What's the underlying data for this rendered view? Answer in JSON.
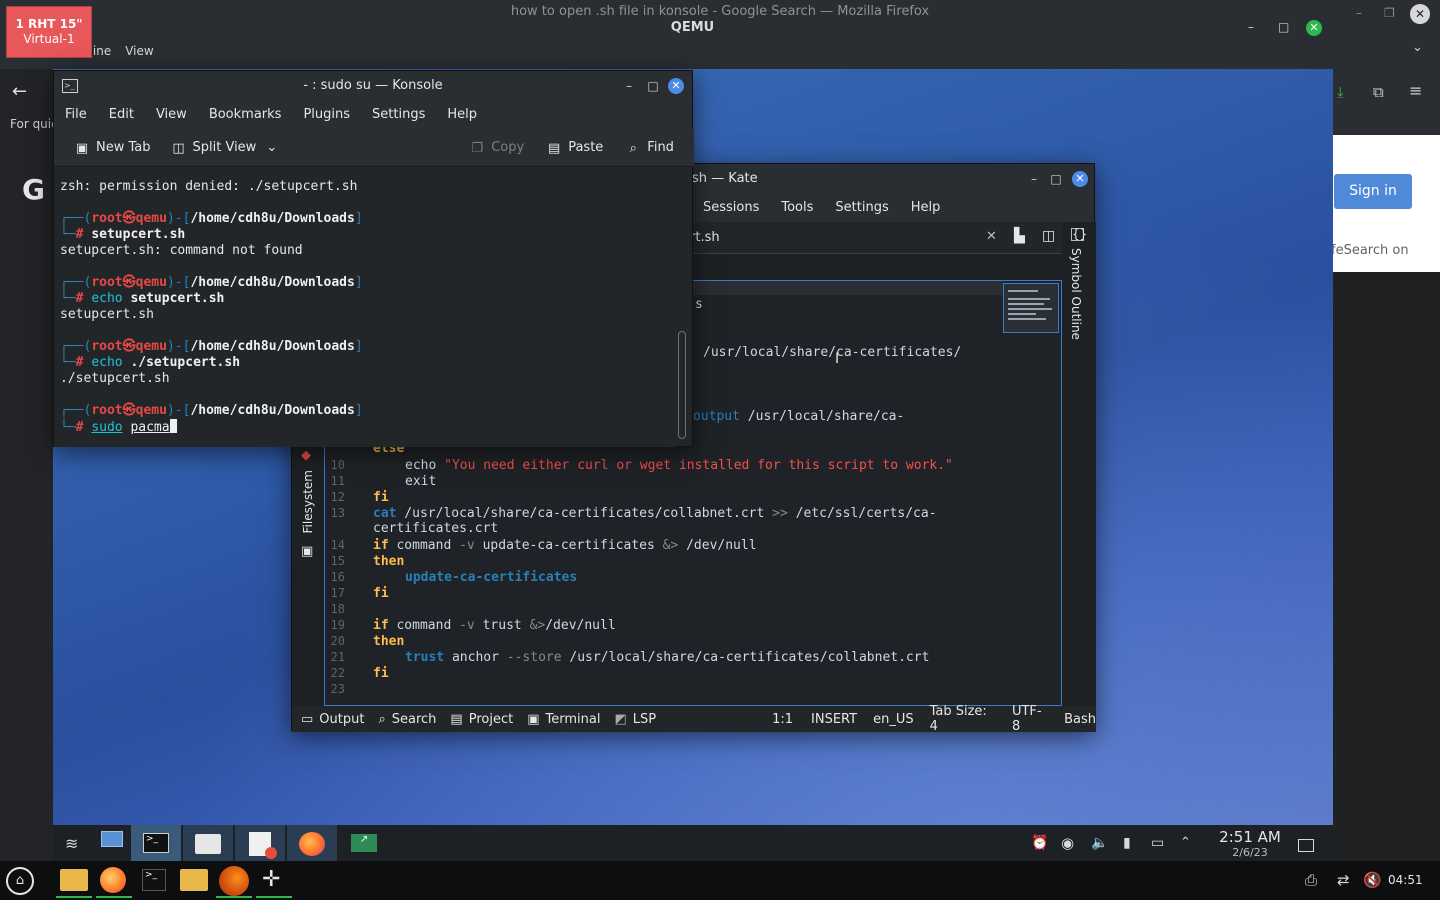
{
  "host": {
    "firefox_title": "how to open .sh file in konsole - Google Search — Mozilla Firefox",
    "qemu_title": "QEMU",
    "menu": [
      "Machine",
      "View"
    ],
    "badge_line1": "1 RHT 15\"",
    "badge_line2": "Virtual-1",
    "clock": "04:51"
  },
  "firefox": {
    "left_hint": "For quic",
    "google_partial": "G",
    "signin": "Sign in",
    "safesearch": "feSearch on"
  },
  "konsole": {
    "title": "- : sudo su — Konsole",
    "menu": [
      "File",
      "Edit",
      "View",
      "Bookmarks",
      "Plugins",
      "Settings",
      "Help"
    ],
    "toolbar": {
      "new_tab": "New Tab",
      "split_view": "Split View",
      "copy": "Copy",
      "paste": "Paste",
      "find": "Find"
    },
    "lines": {
      "l1": "zsh: permission denied: ./setupcert.sh",
      "host": "root",
      "at": "㉿",
      "machine": "qemu",
      "path": "/home/cdh8u/Downloads",
      "cmd1": "setupcert.sh",
      "out1": "setupcert.sh: command not found",
      "cmd2_a": "echo ",
      "cmd2_b": "setupcert.sh",
      "out2": "setupcert.sh",
      "cmd3_a": "echo ",
      "cmd3_b": "./setupcert.sh",
      "out3": "./setupcert.sh",
      "cmd4_a": "sudo",
      "cmd4_b": "pacma"
    }
  },
  "kate": {
    "title": "sh — Kate",
    "menu": [
      "Sessions",
      "Tools",
      "Settings",
      "Help"
    ],
    "tab_name": "rt.sh",
    "symbol_outline": "Symbol Outline",
    "filesystem": "Filesystem",
    "upper_fragments": {
      "s": "s",
      "path1": "/usr/local/share/ca-certificates/",
      "output_kw": "output",
      "path2": " /usr/local/share/ca-"
    },
    "code": {
      "n9": "9",
      "l9": "else",
      "n10": "10",
      "l10_a": "echo ",
      "l10_b": "\"You need either curl or wget installed for this script to work.\"",
      "n11": "11",
      "l11": "exit",
      "n12": "12",
      "l12": "fi",
      "n13": "13",
      "l13_a": "cat",
      "l13_b": " /usr/local/share/ca-certificates/collabnet.crt ",
      "l13_c": ">>",
      "l13_d": " /etc/ssl/certs/ca-",
      "l13_wrap": "certificates.crt",
      "n14": "14",
      "l14_a": "if",
      "l14_b": " command ",
      "l14_c": "-v",
      "l14_d": " update-ca-certificates ",
      "l14_e": "&>",
      "l14_f": " /dev/null",
      "n15": "15",
      "l15": "then",
      "n16": "16",
      "l16": "update-ca-certificates",
      "n17": "17",
      "l17": "fi",
      "n18": "18",
      "n19": "19",
      "l19_a": "if",
      "l19_b": " command ",
      "l19_c": "-v",
      "l19_d": " trust ",
      "l19_e": "&>",
      "l19_f": "/dev/null",
      "n20": "20",
      "l20": "then",
      "n21": "21",
      "l21_a": "trust",
      "l21_b": " anchor ",
      "l21_c": "--store",
      "l21_d": " /usr/local/share/ca-certificates/collabnet.crt",
      "n22": "22",
      "l22": "fi",
      "n23": "23"
    },
    "status": {
      "output": "Output",
      "search": "Search",
      "project": "Project",
      "terminal": "Terminal",
      "lsp": "LSP",
      "position": "1:1",
      "mode": "INSERT",
      "lang": "en_US",
      "tab_size": "Tab Size: 4",
      "encoding": "UTF-8",
      "syntax": "Bash"
    }
  },
  "vm_taskbar": {
    "time": "2:51 AM",
    "date": "2/6/23"
  },
  "colors": {
    "accent": "#3d7cc7",
    "close_button": "#4d8ae8",
    "badge": "#e8575a",
    "root_red": "#e64848"
  }
}
